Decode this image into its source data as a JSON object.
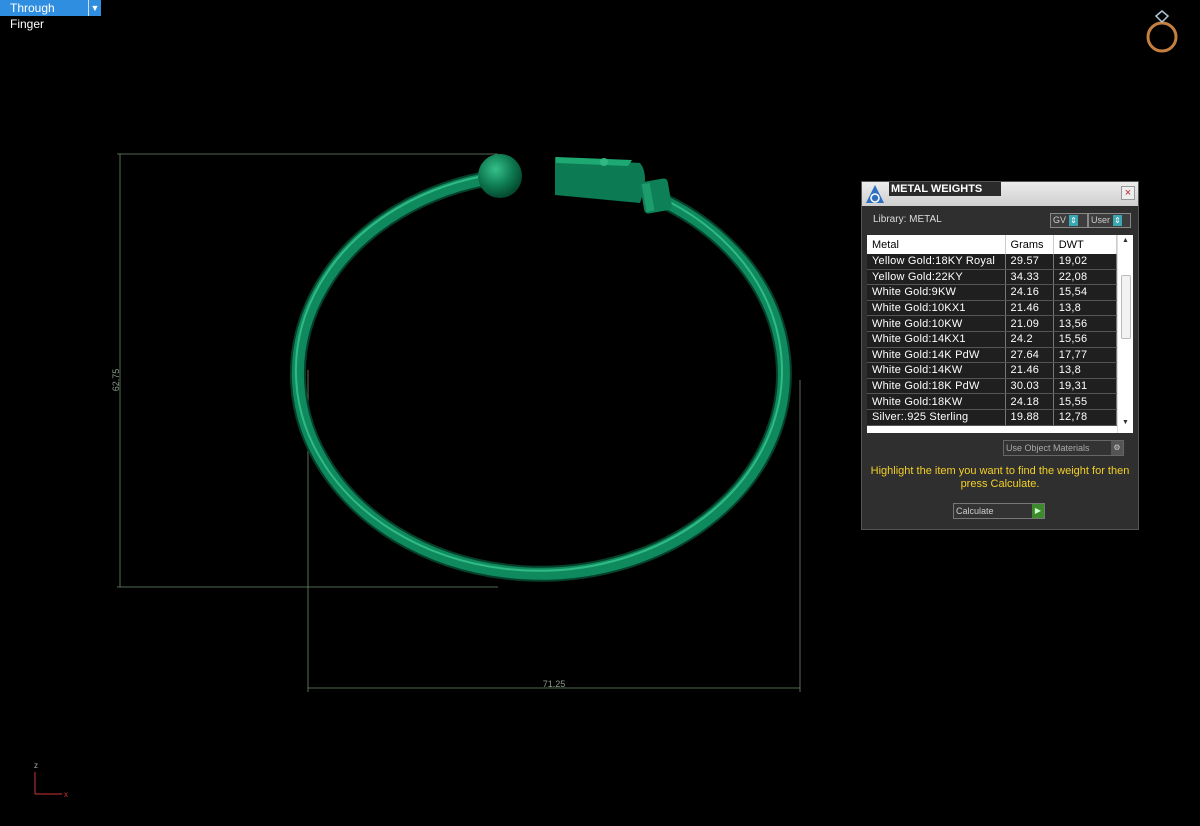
{
  "viewport": {
    "view_mode": "Through Finger",
    "axis_x": "x",
    "axis_z": "z"
  },
  "dimensions": {
    "height": "62.75",
    "width": "71.25"
  },
  "panel": {
    "title": "METAL WEIGHTS",
    "library_label": "Library: METAL",
    "gv_label": "GV",
    "user_label": "User",
    "columns": [
      "Metal",
      "Grams",
      "DWT"
    ],
    "rows": [
      [
        "Yellow Gold:18KY Royal",
        "29.57",
        "19,02"
      ],
      [
        "Yellow Gold:22KY",
        "34.33",
        "22,08"
      ],
      [
        "White Gold:9KW",
        "24.16",
        "15,54"
      ],
      [
        "White Gold:10KX1",
        "21.46",
        "13,8"
      ],
      [
        "White Gold:10KW",
        "21.09",
        "13,56"
      ],
      [
        "White Gold:14KX1",
        "24.2",
        "15,56"
      ],
      [
        "White Gold:14K PdW",
        "27.64",
        "17,77"
      ],
      [
        "White Gold:14KW",
        "21.46",
        "13,8"
      ],
      [
        "White Gold:18K PdW",
        "30.03",
        "19,31"
      ],
      [
        "White Gold:18KW",
        "24.18",
        "15,55"
      ],
      [
        "Silver:.925 Sterling",
        "19.88",
        "12,78"
      ]
    ],
    "use_object_materials": "Use Object Materials",
    "hint": "Highlight the item you want to find the weight for then press Calculate.",
    "calculate_label": "Calculate"
  },
  "colors": {
    "bracelet": "#0f8a5f",
    "dimension_lines": "#6e8a6e",
    "hint_text": "#f2d027",
    "view_button": "#2f8ee0"
  }
}
